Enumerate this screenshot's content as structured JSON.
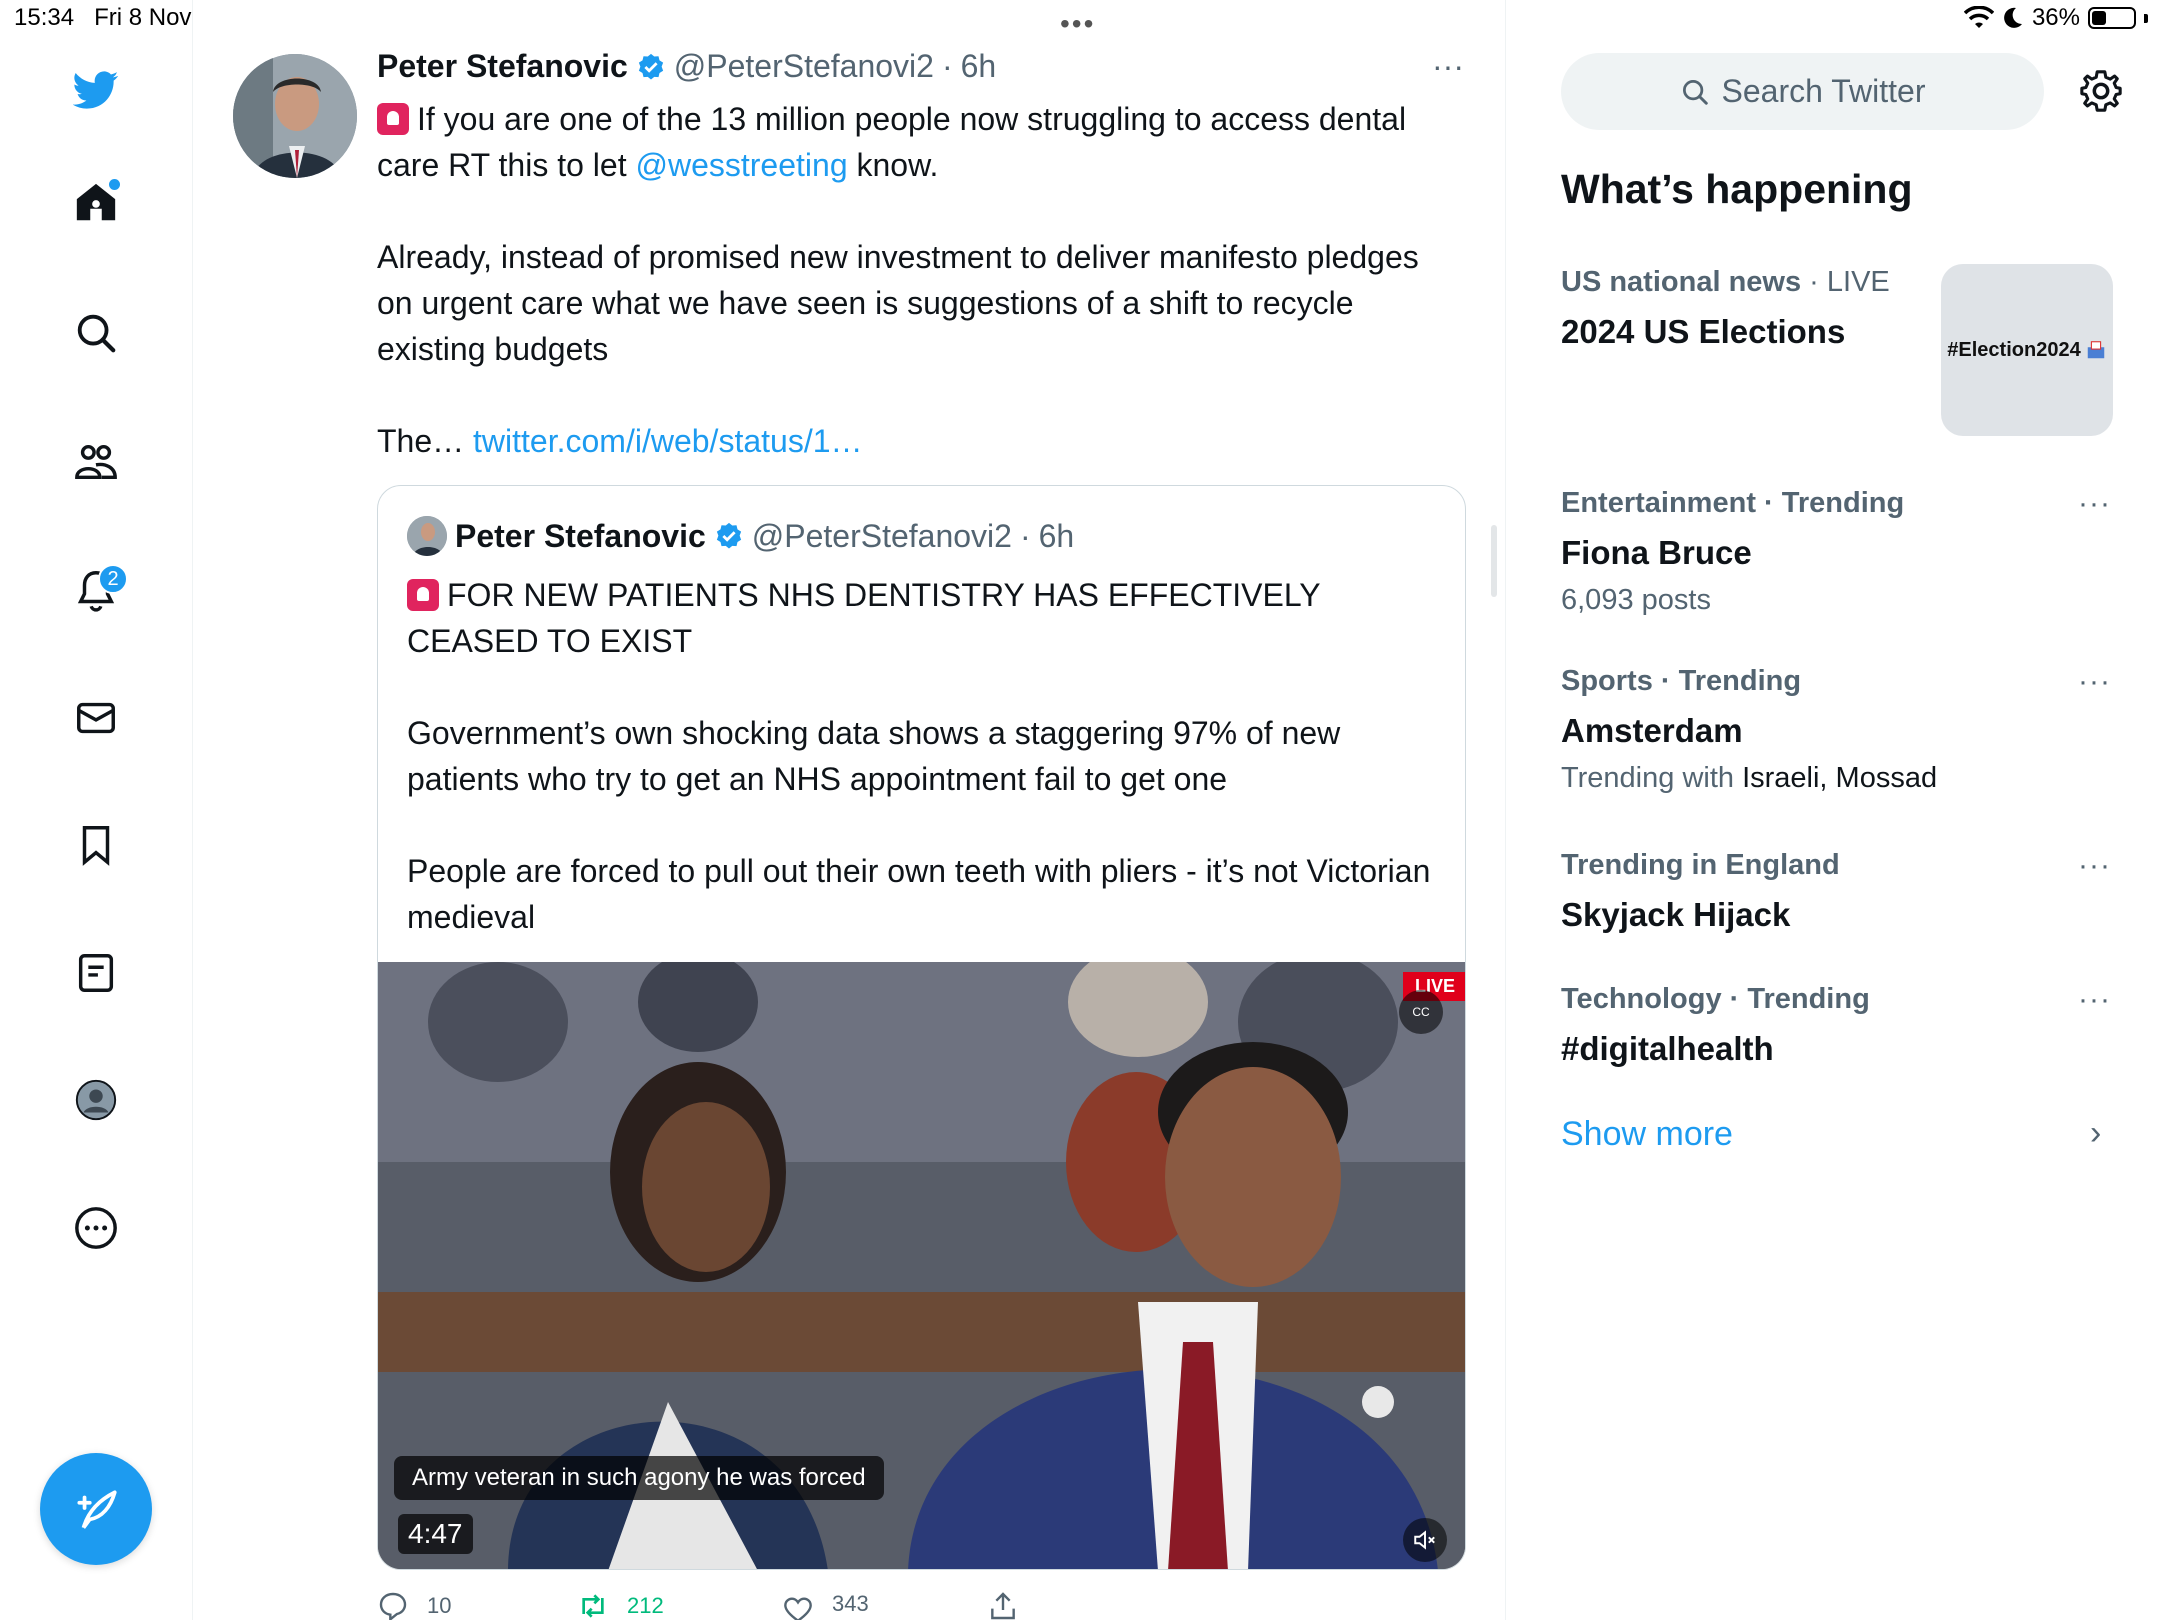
{
  "status_bar": {
    "time": "15:34",
    "date": "Fri 8 Nov",
    "battery": "36%",
    "battery_level": 0.36
  },
  "nav": {
    "notifications_badge": "2",
    "accent": "#1d9bf0"
  },
  "tweet": {
    "author_name": "Peter Stefanovic",
    "handle": "@PeterStefanovi2",
    "time_sep": "·",
    "time": "6h",
    "text_p1_a": "If you are one of the 13 million people now struggling to access dental care RT this to let ",
    "text_p1_mention": "@wesstreeting",
    "text_p1_b": " know.",
    "text_p2": "Already, instead of promised new investment to deliver manifesto pledges on urgent care what we have seen is suggestions of a shift to recycle existing budgets",
    "text_p3_a": "The… ",
    "text_p3_link": "twitter.com/i/web/status/1…",
    "replies": "10",
    "retweets": "212",
    "likes": "343"
  },
  "quote": {
    "author_name": "Peter Stefanovic",
    "handle": "@PeterStefanovi2",
    "time_sep": "·",
    "time": "6h",
    "text_p1": "FOR NEW PATIENTS NHS DENTISTRY HAS EFFECTIVELY CEASED TO EXIST",
    "text_p2": "Government’s own shocking data shows a staggering 97% of new patients who try to get an NHS appointment fail to get one",
    "text_p3": "People are forced to pull out their own teeth with pliers - it’s not Victorian medieval",
    "video": {
      "live_label": "LIVE",
      "cc_label": "CC",
      "caption": "Army veteran in such agony he was forced",
      "duration": "4:47"
    }
  },
  "sidebar": {
    "search_placeholder": "Search Twitter",
    "section_title": "What’s happening",
    "trends": [
      {
        "meta": "US national news",
        "meta_sep": " · ",
        "meta_live": "LIVE",
        "title": "2024 US Elections",
        "thumb_label": "#Election2024"
      },
      {
        "meta": "Entertainment · Trending",
        "title": "Fiona Bruce",
        "sub": "6,093 posts"
      },
      {
        "meta": "Sports · Trending",
        "title": "Amsterdam",
        "sub_prefix": "Trending with ",
        "sub_terms": "Israeli, Mossad"
      },
      {
        "meta": "Trending in England",
        "title": "Skyjack Hijack"
      },
      {
        "meta": "Technology · Trending",
        "title": "#digitalhealth"
      }
    ],
    "show_more": "Show more",
    "more_label": "···"
  }
}
